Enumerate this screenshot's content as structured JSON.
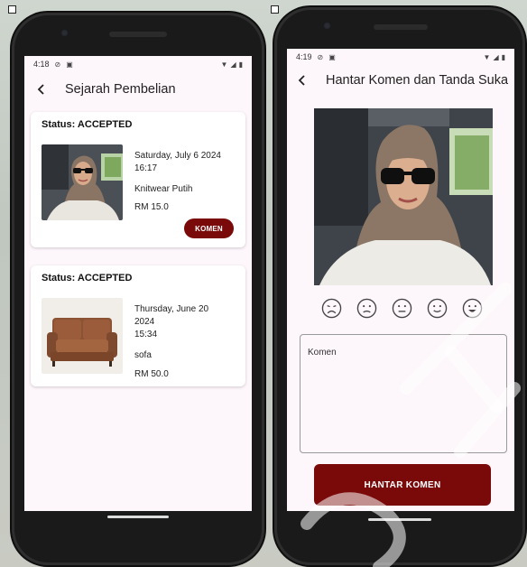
{
  "left_screen": {
    "status_time": "4:18",
    "title": "Sejarah Pembelian",
    "orders": [
      {
        "status": "Status: ACCEPTED",
        "date": "Saturday, July 6 2024",
        "time": "16:17",
        "item": "Knitwear Putih",
        "price": "RM 15.0",
        "button": "KOMEN",
        "image": "woman-selfie-photo"
      },
      {
        "status": "Status: ACCEPTED",
        "date_line1": "Thursday, June 20",
        "date_line2": "2024",
        "time": "15:34",
        "item": "sofa",
        "price": "RM 50.0",
        "image": "brown-sofa-photo"
      }
    ]
  },
  "right_screen": {
    "status_time": "4:19",
    "title": "Hantar Komen dan Tanda Suka",
    "ratings": [
      "very-sad-face-icon",
      "sad-face-icon",
      "neutral-face-icon",
      "smile-face-icon",
      "grin-face-icon"
    ],
    "comment_placeholder": "Komen",
    "submit_label": "HANTAR KOMEN"
  },
  "colors": {
    "accent": "#7a0a0a",
    "screen_bg": "#fdf6fb"
  }
}
